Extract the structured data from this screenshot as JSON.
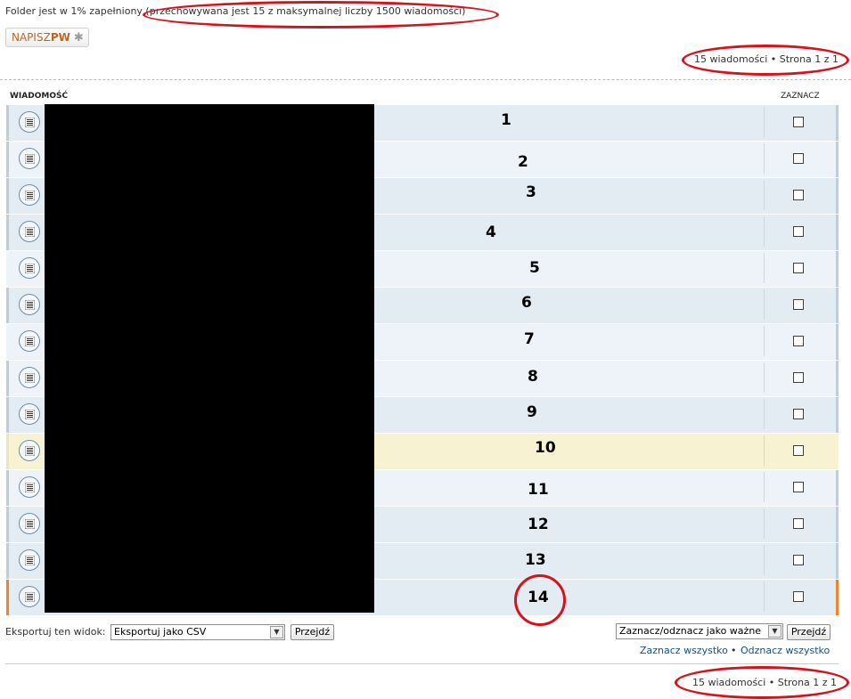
{
  "folder_info": "Folder jest w 1% zapełniony (przechowywana jest 15 z maksymalnej liczby 1500 wiadomości)",
  "compose": {
    "main": "NAPISZ",
    "suffix": "PW",
    "icon": "star-icon"
  },
  "pagination_top": "15 wiadomości • Strona 1 z 1",
  "pagination_bottom": "15 wiadomości • Strona 1 z 1",
  "columns": {
    "message": "WIADOMOŚĆ",
    "select": "ZAZNACZ"
  },
  "rows": [
    {
      "num": "1"
    },
    {
      "num": "2"
    },
    {
      "num": "3"
    },
    {
      "num": "4"
    },
    {
      "num": "5"
    },
    {
      "num": "6"
    },
    {
      "num": "7"
    },
    {
      "num": "8"
    },
    {
      "num": "9"
    },
    {
      "num": "10"
    },
    {
      "num": "11"
    },
    {
      "num": "12"
    },
    {
      "num": "13"
    },
    {
      "num": "14"
    }
  ],
  "export": {
    "label": "Eksportuj ten widok:",
    "selected": "Eksportuj jako CSV",
    "go": "Przejdź"
  },
  "mark": {
    "selected": "Zaznacz/odznacz jako ważne",
    "go": "Przejdź"
  },
  "links": {
    "select_all": "Zaznacz wszystko",
    "separator": "•",
    "deselect_all": "Odznacz wszystko"
  },
  "colors": {
    "row": "#e3ebf3",
    "row_alt": "#edf3f8",
    "highlight": "#f6f2d2",
    "unread_marker": "#f1832d",
    "annotation": "#d8121b",
    "link": "#105289"
  }
}
